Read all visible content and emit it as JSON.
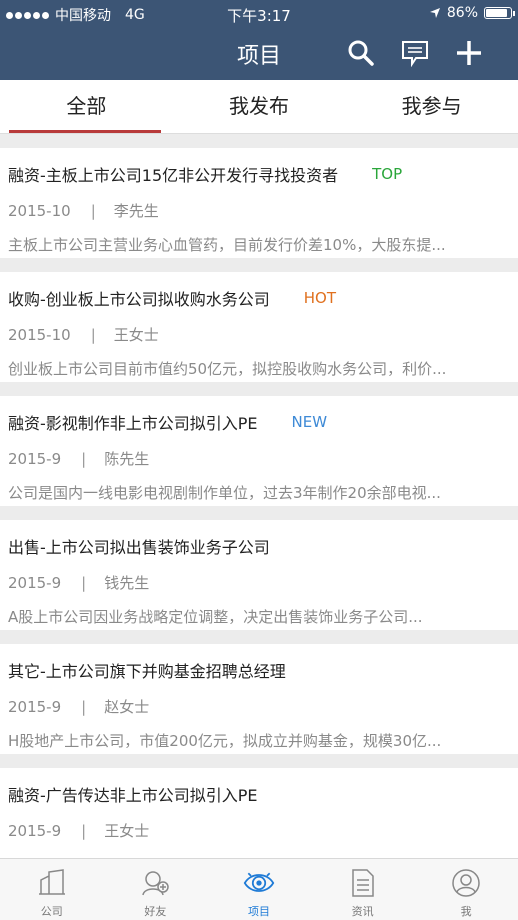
{
  "status_bar": {
    "carrier": "中国移动",
    "network": "4G",
    "time": "下午3:17",
    "battery": "86%",
    "battery_level": 0.86
  },
  "header": {
    "title": "项目",
    "icons": [
      "search-icon",
      "message-icon",
      "add-icon"
    ]
  },
  "tabs": [
    {
      "label": "全部",
      "active": true
    },
    {
      "label": "我发布",
      "active": false
    },
    {
      "label": "我参与",
      "active": false
    }
  ],
  "items": [
    {
      "title": "融资-主板上市公司15亿非公开发行寻找投资者",
      "badge": "TOP",
      "badge_color": "#2aa63a",
      "date": "2015-10",
      "sep": "|",
      "person": "李先生",
      "desc": "主板上市公司主营业务心血管药，目前发行价差10%，大股东提..."
    },
    {
      "title": "收购-创业板上市公司拟收购水务公司",
      "badge": "HOT",
      "badge_color": "#e0701e",
      "date": "2015-10",
      "sep": "|",
      "person": "王女士",
      "desc": "创业板上市公司目前市值约50亿元，拟控股收购水务公司，利价..."
    },
    {
      "title": "融资-影视制作非上市公司拟引入PE",
      "badge": "NEW",
      "badge_color": "#3e8ad6",
      "date": "2015-9",
      "sep": "|",
      "person": "陈先生",
      "desc": "公司是国内一线电影电视剧制作单位，过去3年制作20余部电视..."
    },
    {
      "title": "出售-上市公司拟出售装饰业务子公司",
      "badge": "",
      "badge_color": "",
      "date": "2015-9",
      "sep": "|",
      "person": "钱先生",
      "desc": "A股上市公司因业务战略定位调整，决定出售装饰业务子公司..."
    },
    {
      "title": "其它-上市公司旗下并购基金招聘总经理",
      "badge": "",
      "badge_color": "",
      "date": "2015-9",
      "sep": "|",
      "person": "赵女士",
      "desc": "H股地产上市公司，市值200亿元，拟成立并购基金，规模30亿..."
    },
    {
      "title": "融资-广告传达非上市公司拟引入PE",
      "badge": "",
      "badge_color": "",
      "date": "2015-9",
      "sep": "|",
      "person": "王女士",
      "desc": ""
    }
  ],
  "bottom_nav": [
    {
      "label": "公司",
      "icon": "company-icon",
      "active": false
    },
    {
      "label": "好友",
      "icon": "friends-icon",
      "active": false
    },
    {
      "label": "项目",
      "icon": "eye-icon",
      "active": true
    },
    {
      "label": "资讯",
      "icon": "news-icon",
      "active": false
    },
    {
      "label": "我",
      "icon": "profile-icon",
      "active": false
    }
  ],
  "colors": {
    "header_bg": "#3c5575",
    "tab_indicator": "#b83a3a",
    "active_nav": "#1f7bd6"
  }
}
